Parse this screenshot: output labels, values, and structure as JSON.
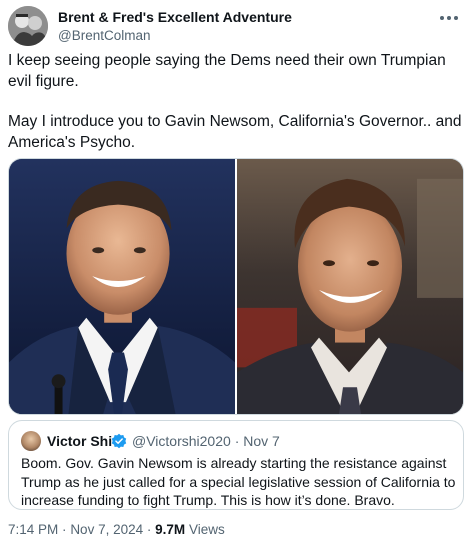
{
  "author": {
    "name": "Brent & Fred's Excellent Adventure",
    "handle": "@BrentColman"
  },
  "tweet": {
    "paragraphs": [
      "I keep seeing people saying the Dems need their own Trumpian evil figure.",
      "May I introduce you to Gavin Newsom, California's Governor.. and America's Psycho."
    ]
  },
  "media": {
    "left_photo": "Gavin Newsom portrait",
    "right_photo": "American Psycho film still"
  },
  "quote": {
    "name": "Victor Shi",
    "verified": true,
    "handle": "@Victorshi2020",
    "separator": "·",
    "date": "Nov 7",
    "text": "Boom. Gov. Gavin Newsom is already starting the resistance against Trump as he just called for a special legislative session of California to increase funding to fight Trump. This is how it’s done. Bravo."
  },
  "meta": {
    "time": "7:14 PM",
    "separator": "·",
    "date": "Nov 7, 2024",
    "views_count": "9.7M",
    "views_label": "Views"
  },
  "icons": {
    "more": "more-options-icon",
    "verified": "verified-badge-icon"
  },
  "colors": {
    "text": "#0f1419",
    "secondary": "#536471",
    "border": "#cfd9de",
    "verified": "#1d9bf0"
  }
}
